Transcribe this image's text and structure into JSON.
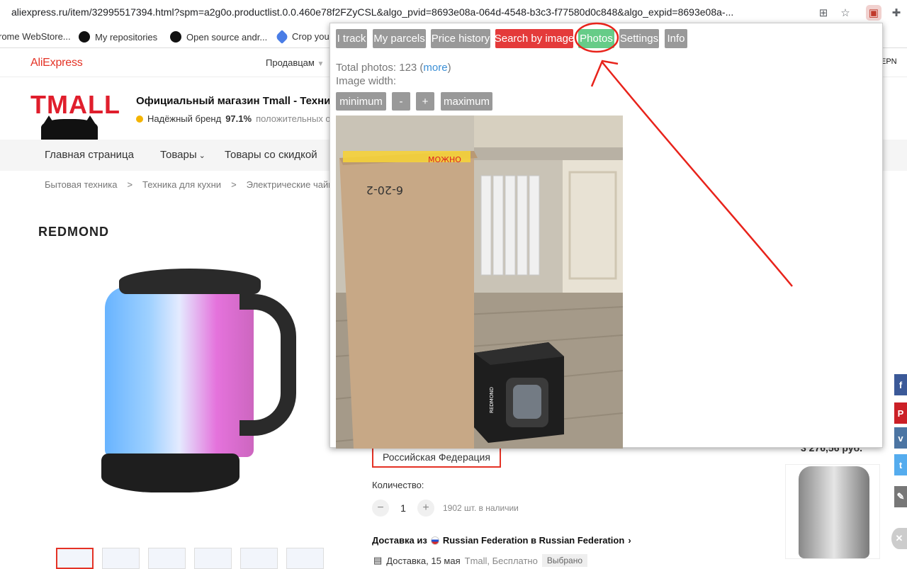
{
  "browser": {
    "url": "aliexpress.ru/item/32995517394.html?spm=a2g0o.productlist.0.0.460e78f2FZyCSL&algo_pvid=8693e08a-064d-4548-b3c3-f77580d0c848&algo_expid=8693e08a-..."
  },
  "bookmarks": [
    {
      "label": "rome WebStore..."
    },
    {
      "label": "My repositories"
    },
    {
      "label": "Open source andr..."
    },
    {
      "label": "Crop you"
    }
  ],
  "extension_side_label": "EPN",
  "site": {
    "logo": "AliExpress",
    "sellers_label": "Продавцам",
    "tmall_logo": "TMALL",
    "store_title": "Официальный магазин Tmall - Техни",
    "trusted_brand": "Надёжный бренд",
    "rating": "97.1%",
    "rating_suffix": "положительных от",
    "nav": [
      "Главная страница",
      "Товары",
      "Товары со скидкой"
    ],
    "breadcrumbs": [
      "Бытовая техника",
      ">",
      "Техника для кухни",
      ">",
      "Электрические чайни"
    ],
    "brand": "REDMOND"
  },
  "product": {
    "country": "Российская Федерация",
    "quantity_label": "Количество:",
    "quantity": "1",
    "stock": "1902 шт. в наличии",
    "ship_from": "Доставка из",
    "ship_route": "Russian Federation в Russian Federation",
    "delivery": "Доставка, 15 мая",
    "delivery_carrier": "Tmall, Бесплатно",
    "chosen": "Выбрано",
    "price_partial": "3 276,56 руб."
  },
  "popup": {
    "tabs": [
      {
        "label": "I track",
        "state": "normal"
      },
      {
        "label": "My parcels",
        "state": "normal"
      },
      {
        "label": "Price history",
        "state": "normal"
      },
      {
        "label": "Search by image",
        "state": "red"
      },
      {
        "label": "Photos",
        "state": "active"
      },
      {
        "label": "Settings",
        "state": "normal"
      },
      {
        "label": "Info",
        "state": "normal"
      }
    ],
    "total_photos_text": "Total photos: 123 (",
    "more_link": "more",
    "total_photos_close": ")",
    "image_width_label": "Image width:",
    "width_buttons": [
      "minimum",
      "-",
      "+",
      "maximum"
    ],
    "photo_box_text_1": "6-20-2",
    "photo_box_text_2": "МОЖНО",
    "photo_small_box_brand": "REDMOND"
  },
  "colors": {
    "ali_red": "#e43225",
    "popup_btn_gray": "#999999",
    "popup_btn_red": "#e43a3a",
    "popup_btn_green": "#66cc88",
    "annotation_red": "#e8231b"
  },
  "share_icons": [
    "facebook-icon",
    "pinterest-icon",
    "vk-icon",
    "twitter-icon",
    "edit-icon"
  ]
}
